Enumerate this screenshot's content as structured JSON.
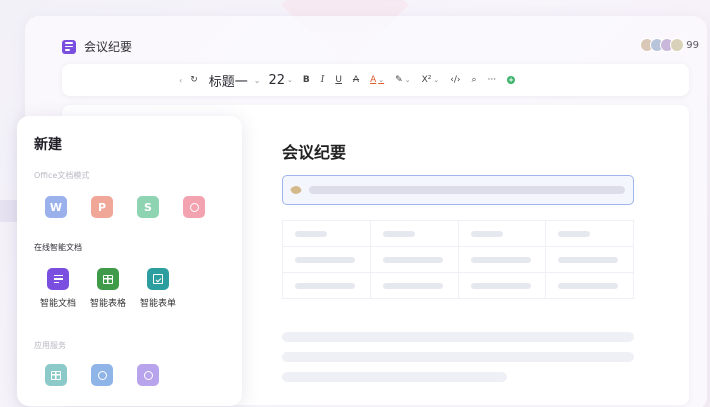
{
  "header": {
    "title": "会议纪要",
    "avatar_count": "99"
  },
  "toolbar": {
    "undo": "‹",
    "redo": "↻",
    "heading": "标题一",
    "font_size": "22",
    "bold": "B",
    "italic": "I",
    "underline": "U",
    "strike": "A",
    "text_color": "A",
    "highlight": "✎",
    "superscript": "X²",
    "code": "‹/›",
    "search": "⌕",
    "more": "···",
    "add": "+"
  },
  "editor": {
    "title": "会议纪要",
    "colors": {
      "input_border": "#9fb6ec",
      "skeleton": "#e6e8ef"
    }
  },
  "new_panel": {
    "title": "新建",
    "office_section": {
      "label": "Office文档模式",
      "apps": [
        {
          "letter": "W",
          "color": "#9bb1ec",
          "icon": "word-icon"
        },
        {
          "letter": "P",
          "color": "#f0a797",
          "icon": "powerpoint-icon"
        },
        {
          "letter": "S",
          "color": "#8fd4b2",
          "icon": "spreadsheet-icon"
        },
        {
          "letter": "",
          "color": "#f3a2b0",
          "icon": "flowchart-icon"
        }
      ]
    },
    "smart_section": {
      "label": "在线智能文档",
      "apps": [
        {
          "label": "智能文档",
          "color": "#7a4fe0",
          "icon": "smart-doc-icon"
        },
        {
          "label": "智能表格",
          "color": "#3f9a4a",
          "icon": "smart-sheet-icon"
        },
        {
          "label": "智能表单",
          "color": "#2d9ea0",
          "icon": "smart-form-icon"
        }
      ]
    },
    "apps_section": {
      "label": "应用服务",
      "apps": [
        {
          "color": "#8cc9c9",
          "icon": "app-service-icon"
        },
        {
          "color": "#8fb4e8",
          "icon": "app-link-icon"
        },
        {
          "color": "#b8a4ec",
          "icon": "app-circle-icon"
        }
      ]
    }
  }
}
